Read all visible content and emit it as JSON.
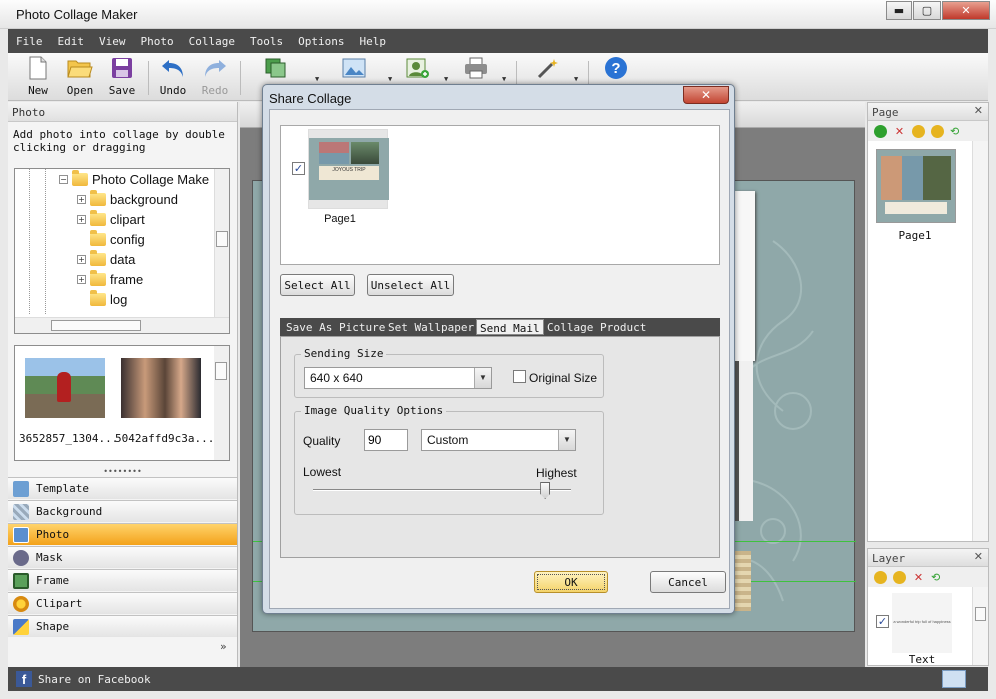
{
  "app": {
    "title": "Photo Collage Maker"
  },
  "window_controls": {
    "minimize": "▬",
    "maximize": "▢",
    "close": "✕"
  },
  "menu": [
    "File",
    "Edit",
    "View",
    "Photo",
    "Collage",
    "Tools",
    "Options",
    "Help"
  ],
  "toolbar": {
    "new": "New",
    "open": "Open",
    "save": "Save",
    "undo": "Undo",
    "redo": "Redo",
    "truncated": "T"
  },
  "left_panel": {
    "header": "Photo",
    "hint": "Add photo into collage by double clicking or dragging",
    "tree": {
      "root": "Photo Collage Make",
      "items": [
        {
          "label": "background",
          "expandable": true
        },
        {
          "label": "clipart",
          "expandable": true
        },
        {
          "label": "config",
          "expandable": false
        },
        {
          "label": "data",
          "expandable": true
        },
        {
          "label": "frame",
          "expandable": true
        },
        {
          "label": "log",
          "expandable": false
        }
      ]
    },
    "thumbnails": [
      {
        "caption": "3652857_1304..."
      },
      {
        "caption": "5042affd9c3a..."
      }
    ],
    "nav": [
      "Template",
      "Background",
      "Photo",
      "Mask",
      "Frame",
      "Clipart",
      "Shape"
    ],
    "nav_active": "Photo",
    "more": "»"
  },
  "right_page": {
    "header": "Page",
    "page_label": "Page1"
  },
  "right_layer": {
    "header": "Layer",
    "layer_label": "Text",
    "layer_preview_text": "a wonderful trip full of happiness"
  },
  "status": {
    "facebook": "Share on Facebook"
  },
  "dialog": {
    "title": "Share Collage",
    "close": "✕",
    "page_item": {
      "label": "Page1",
      "checked": true,
      "thumb_title": "JOYOUS TRIP"
    },
    "select_all": "Select All",
    "unselect_all": "Unselect All",
    "tabs": [
      "Save As Picture",
      "Set Wallpaper",
      "Send Mail",
      "Collage Product"
    ],
    "active_tab": "Send Mail",
    "sending_size": {
      "legend": "Sending Size",
      "value": "640 x 640",
      "original_size_label": "Original Size",
      "original_size_checked": false
    },
    "quality": {
      "legend": "Image Quality Options",
      "label": "Quality",
      "value": "90",
      "preset": "Custom",
      "lowest": "Lowest",
      "highest": "Highest",
      "slider_percent": 90
    },
    "ok": "OK",
    "cancel": "Cancel"
  },
  "colors": {
    "menubar": "#4a4a4a",
    "active_nav": "#f3a21b",
    "canvas": "#8fa8a9",
    "dialog_frame": "#d4dde7"
  }
}
